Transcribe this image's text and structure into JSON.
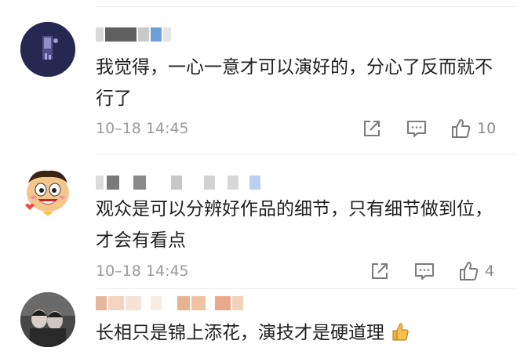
{
  "comments": [
    {
      "text": "我觉得，一心一意才可以演好的，分心了反而就不行了",
      "time": "10–18 14:45",
      "like_count": "10"
    },
    {
      "text": "观众是可以分辨好作品的细节，只有细节做到位，才会有看点",
      "time": "10–18 14:45",
      "like_count": "4"
    },
    {
      "text": "长相只是锦上添花，演技才是硬道理"
    }
  ],
  "icons": {
    "share": "share-icon",
    "comment": "comment-icon",
    "like": "thumbs-up-icon",
    "emoji": "thumbs-up-emoji-icon"
  },
  "colors": {
    "text": "#1f1f1f",
    "meta": "#9a9a9a",
    "icon": "#7a7a7a",
    "divider": "#ececec"
  }
}
